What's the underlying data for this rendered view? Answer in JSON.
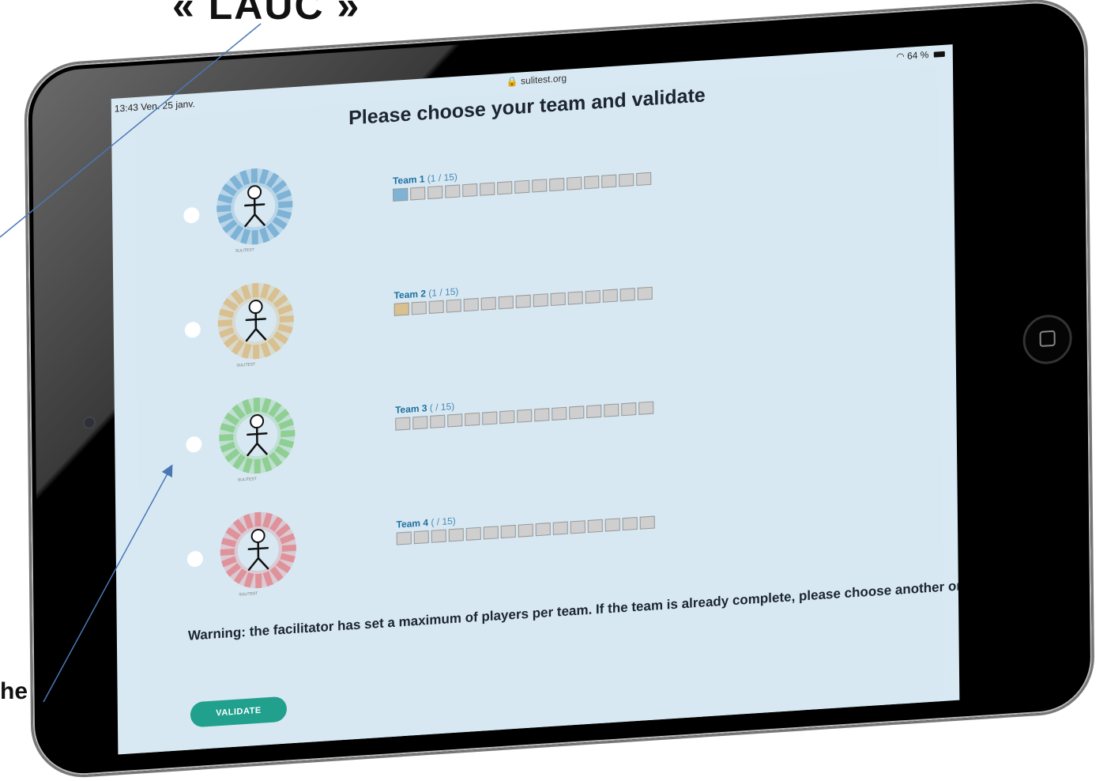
{
  "callouts": {
    "top": "« LAUC »",
    "bottom": "he"
  },
  "status_bar": {
    "time": "13:43",
    "date": "Ven. 25 janv.",
    "url": "sulitest.org",
    "battery": "64 %"
  },
  "page": {
    "title": "Please choose your team and validate",
    "warning": "Warning: the facilitator has set a maximum of players per team. If the team is already complete, please choose another one.",
    "validate_label": "VALIDATE"
  },
  "teams": [
    {
      "label": "Team 1",
      "count": "(1 / 15)",
      "filled": 1,
      "capacity": 15,
      "color": "#7fb3d6",
      "avatar_icon": "meditating-figure-icon",
      "mark": "SULITEST"
    },
    {
      "label": "Team 2",
      "count": "(1 / 15)",
      "filled": 1,
      "capacity": 15,
      "color": "#d9c090",
      "avatar_icon": "walking-figure-icon",
      "mark": "SULITEST"
    },
    {
      "label": "Team 3",
      "count": "( / 15)",
      "filled": 0,
      "capacity": 15,
      "color": "#8fcf94",
      "avatar_icon": "dancing-figure-icon",
      "mark": "SULITEST"
    },
    {
      "label": "Team 4",
      "count": "( / 15)",
      "filled": 0,
      "capacity": 15,
      "color": "#e0929b",
      "avatar_icon": "jumping-figure-icon",
      "mark": "SULITEST"
    }
  ]
}
